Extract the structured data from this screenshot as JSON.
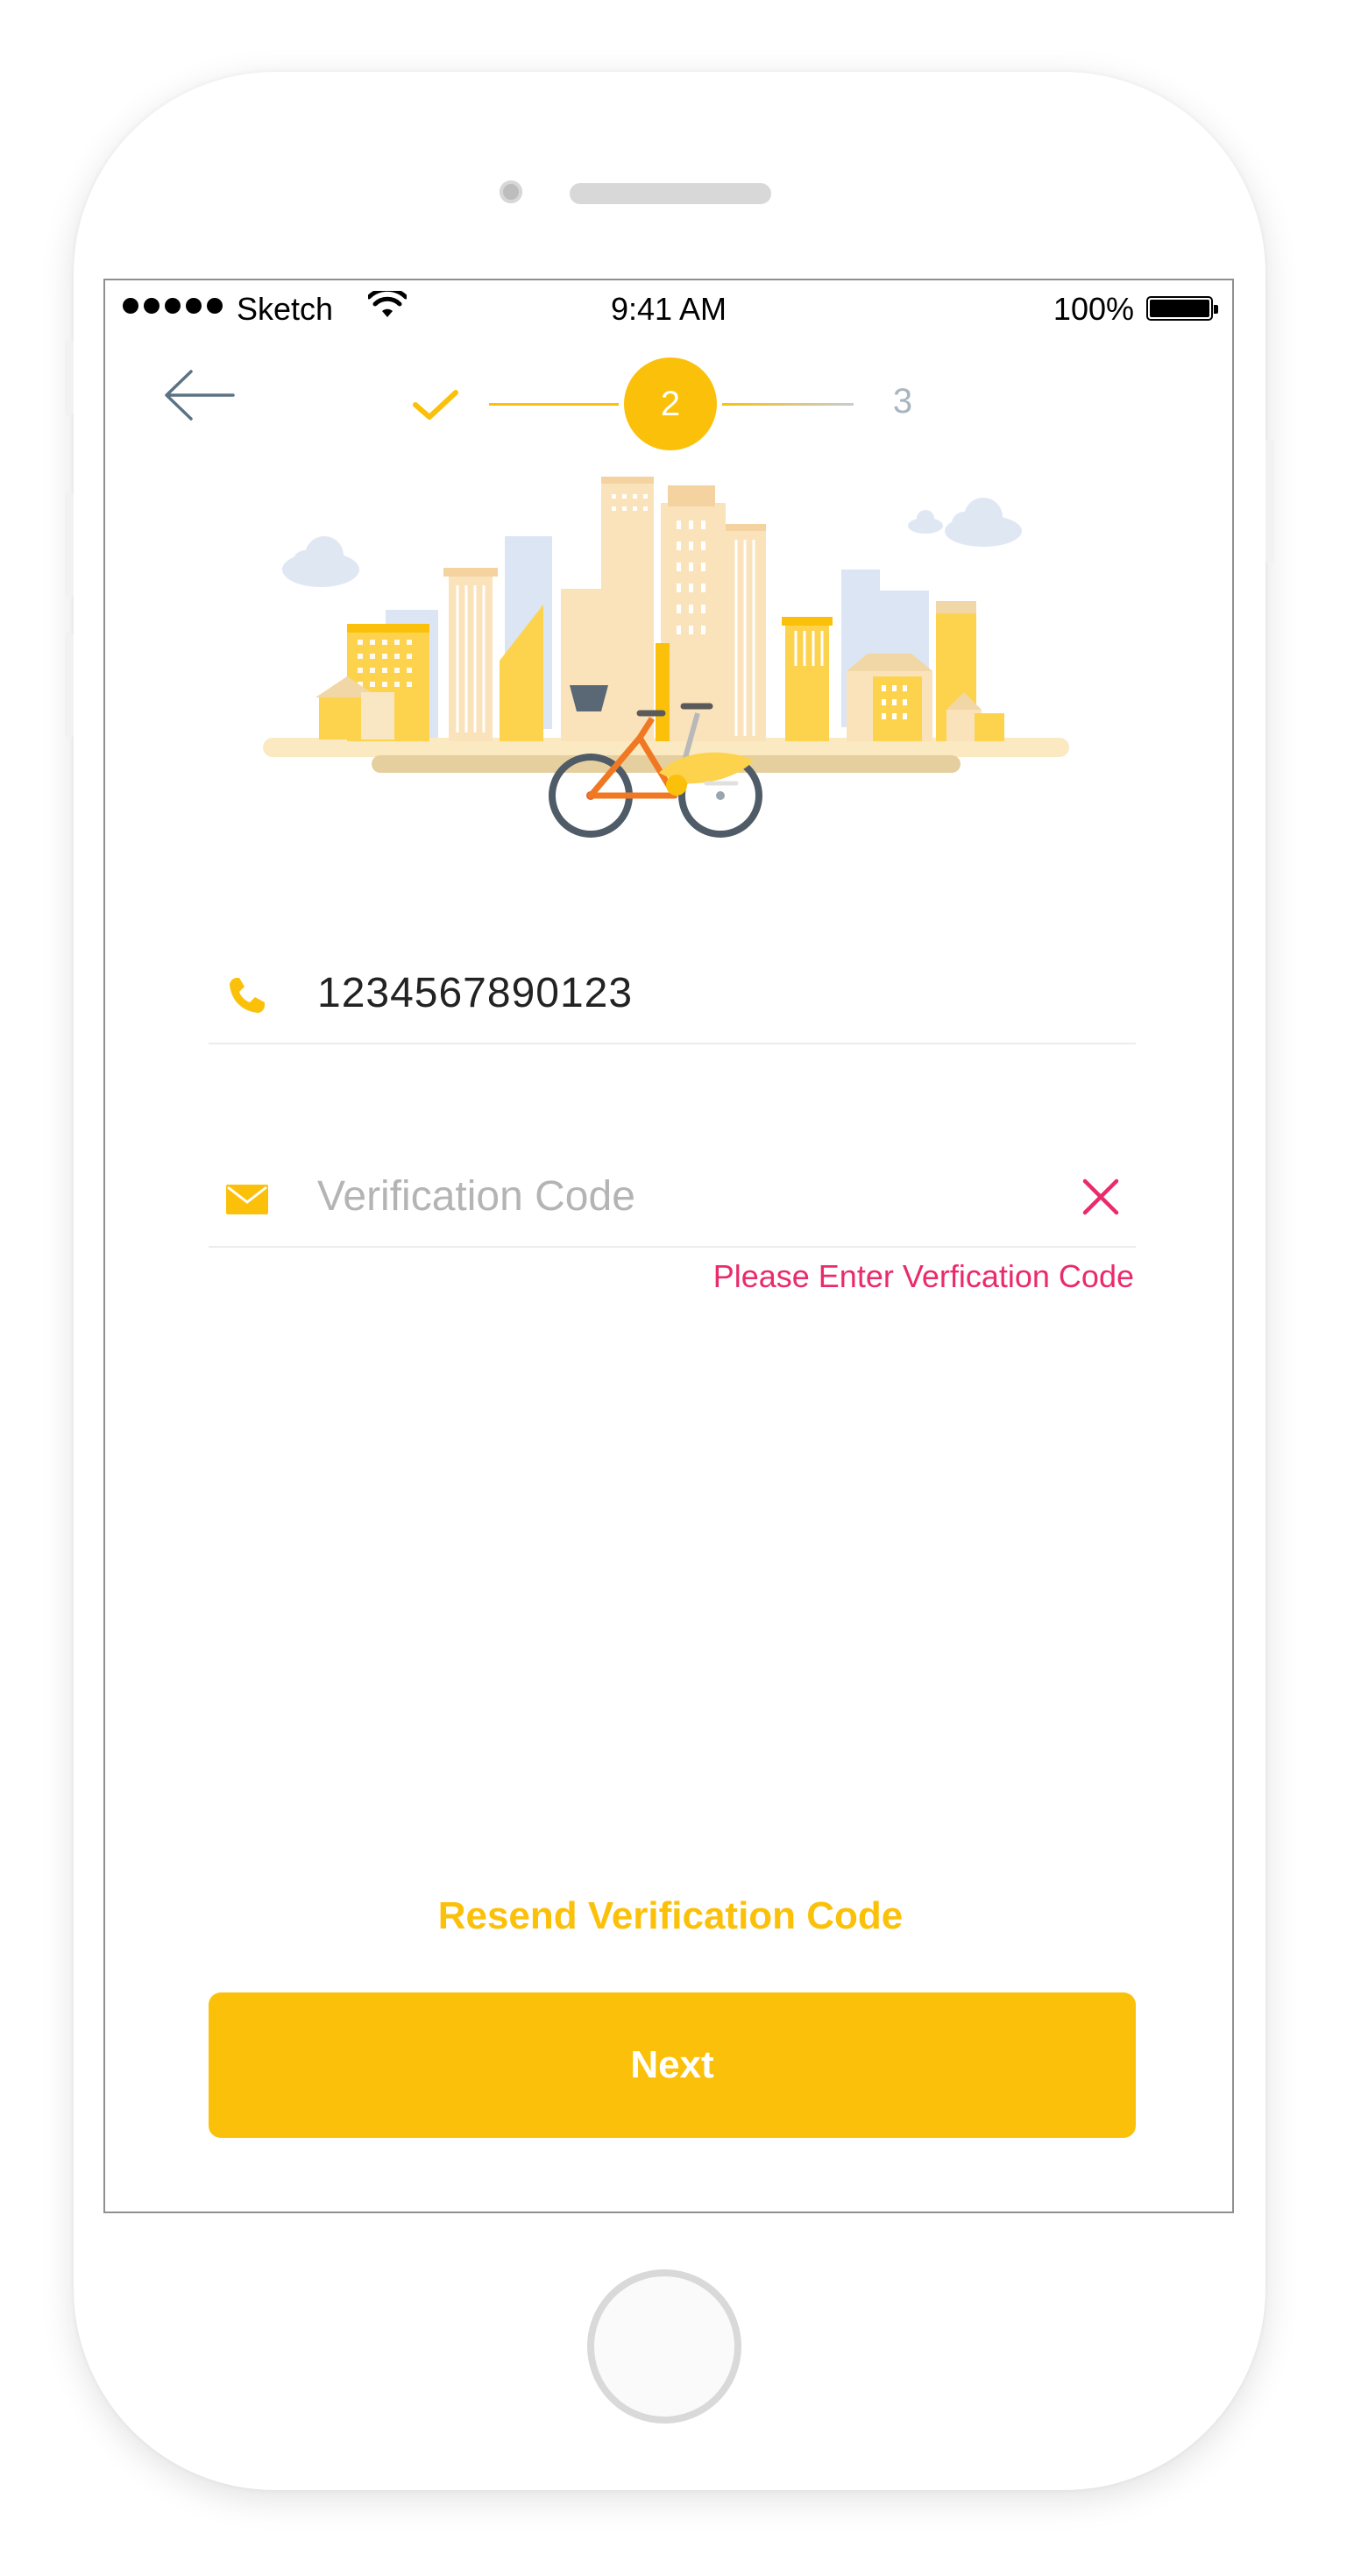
{
  "status_bar": {
    "carrier": "Sketch",
    "time": "9:41 AM",
    "battery": "100%"
  },
  "navigation": {
    "back_icon": "arrow-left-icon"
  },
  "stepper": {
    "completed_icon": "checkmark-icon",
    "current_step": "2",
    "next_step": "3"
  },
  "illustration": {
    "subject": "city-skyline-with-bike-icon"
  },
  "form": {
    "phone": {
      "icon": "phone-icon",
      "value": "1234567890123"
    },
    "verification": {
      "icon": "envelope-icon",
      "placeholder": "Verification Code",
      "clear_icon": "close-icon",
      "error": "Please Enter Verfication Code"
    }
  },
  "actions": {
    "resend_label": "Resend Verification Code",
    "next_label": "Next"
  },
  "colors": {
    "accent": "#fbc10a",
    "error": "#ea2b6a",
    "placeholder": "#b4b4b4"
  }
}
